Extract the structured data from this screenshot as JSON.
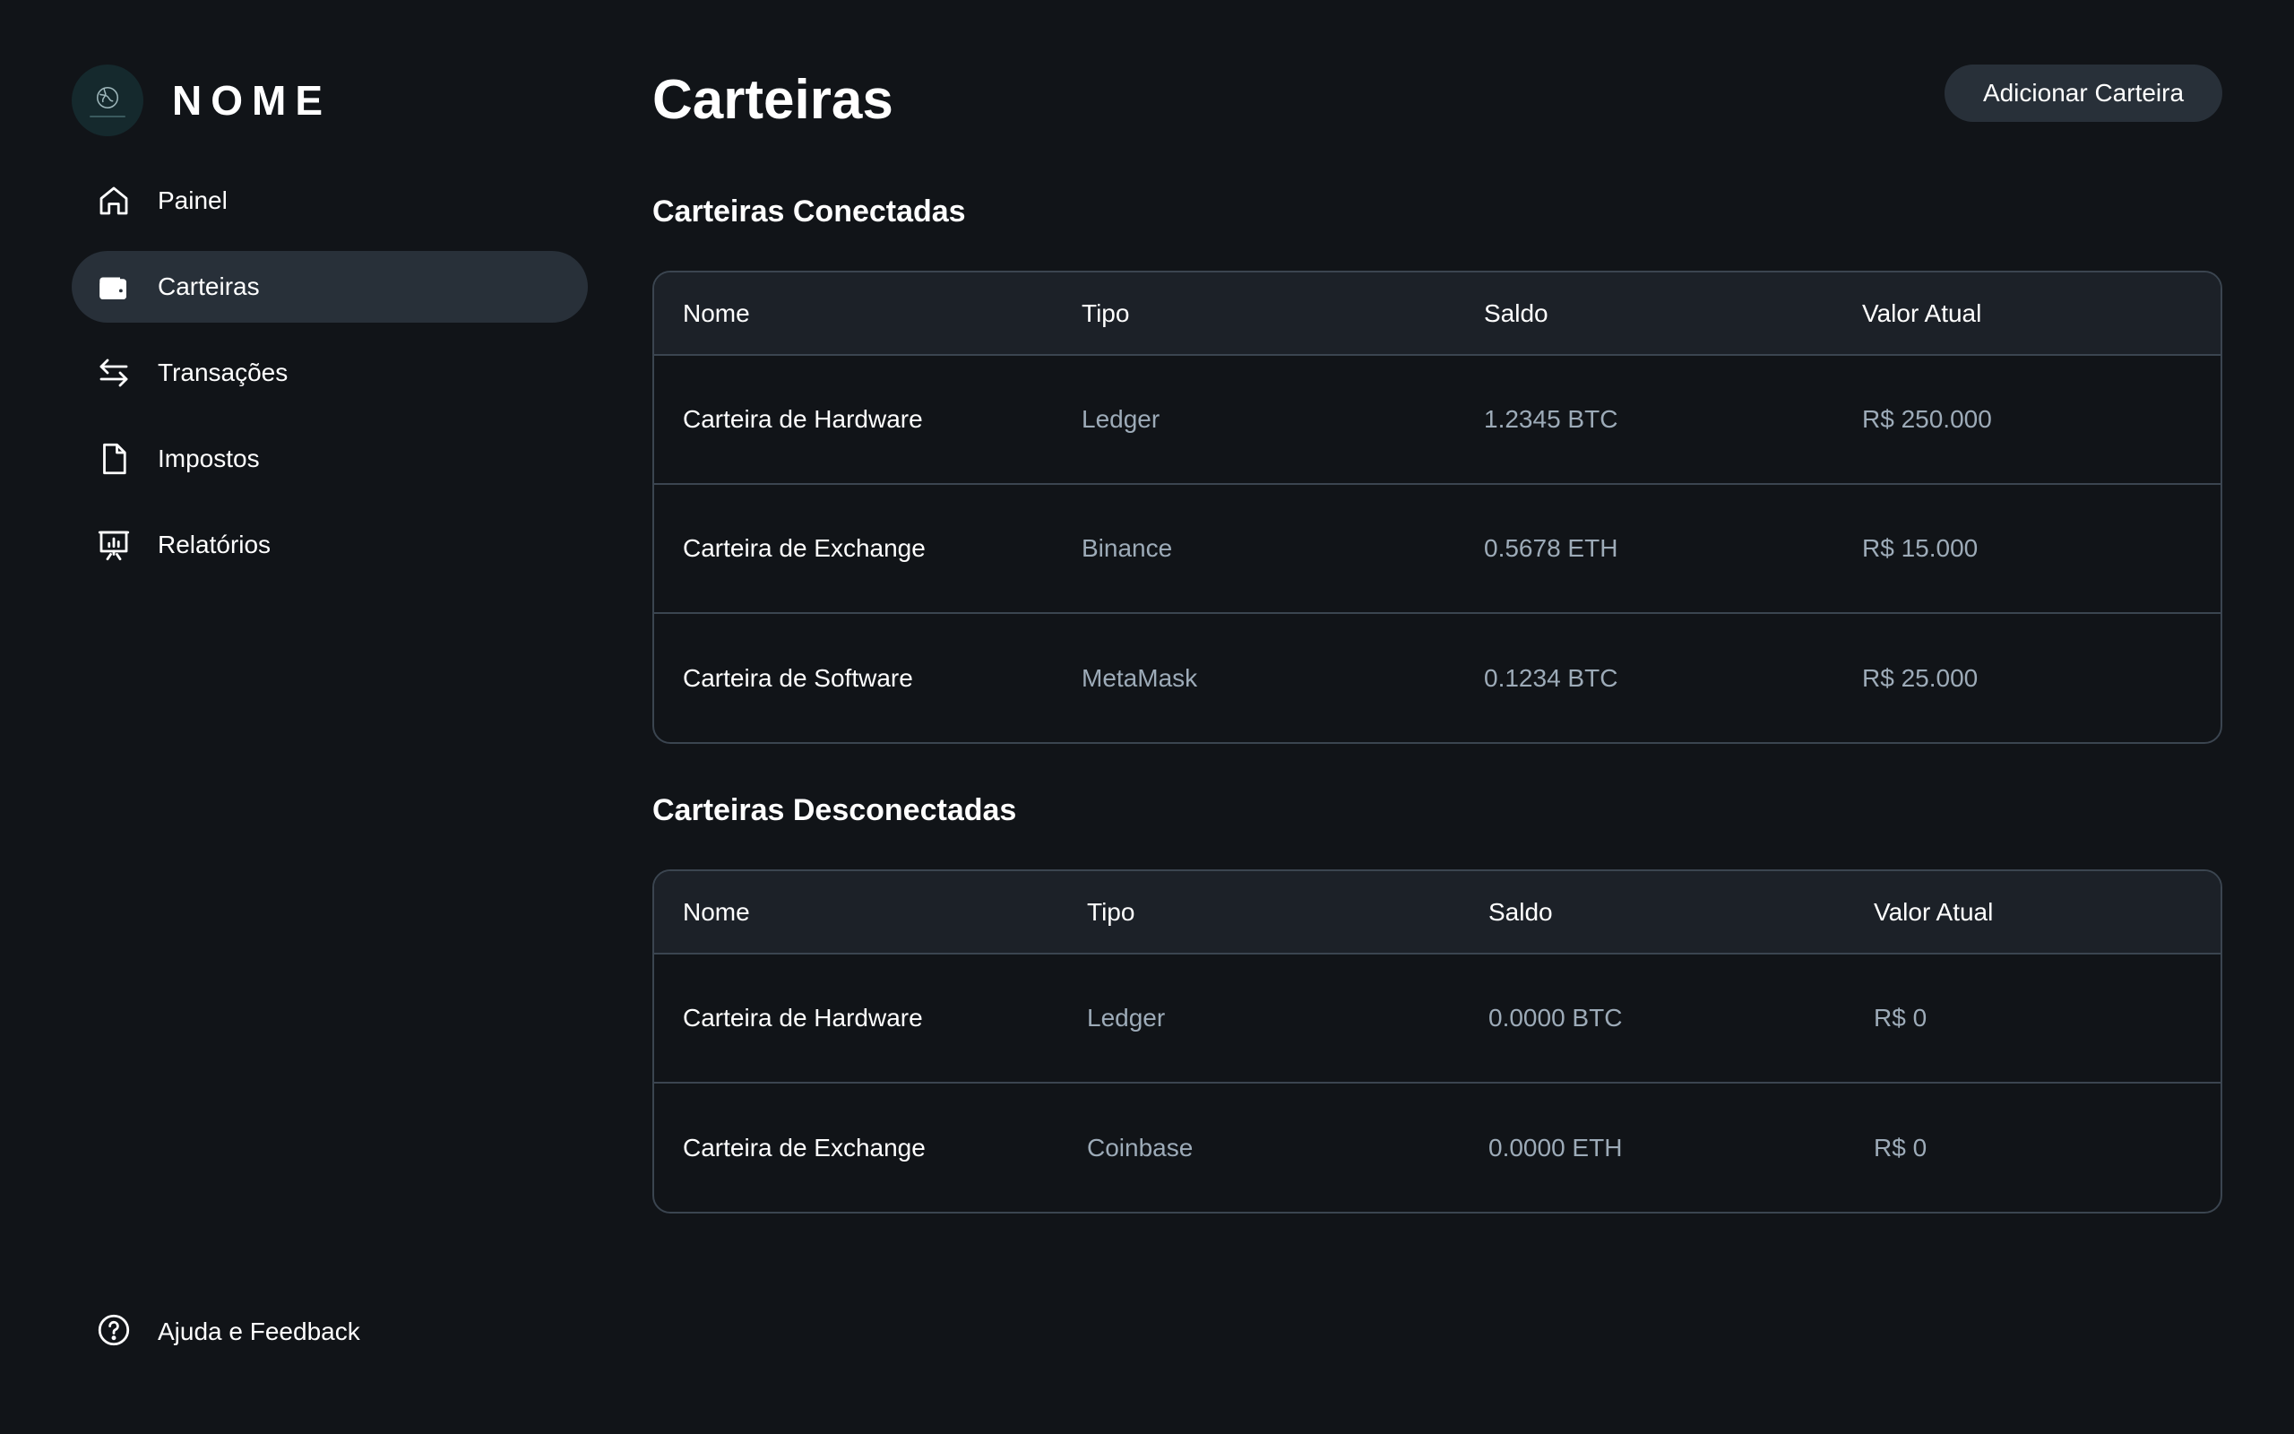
{
  "brand": {
    "name": "NOME",
    "logo_icon": "globe-icon"
  },
  "sidebar": {
    "items": [
      {
        "label": "Painel",
        "icon": "home-icon",
        "active": false
      },
      {
        "label": "Carteiras",
        "icon": "wallet-icon",
        "active": true
      },
      {
        "label": "Transações",
        "icon": "arrows-swap-icon",
        "active": false
      },
      {
        "label": "Impostos",
        "icon": "document-icon",
        "active": false
      },
      {
        "label": "Relatórios",
        "icon": "presentation-chart-icon",
        "active": false
      }
    ],
    "help": {
      "label": "Ajuda e Feedback",
      "icon": "help-circle-icon"
    }
  },
  "header": {
    "title": "Carteiras",
    "add_button": "Adicionar Carteira"
  },
  "connected": {
    "title": "Carteiras Conectadas",
    "columns": [
      "Nome",
      "Tipo",
      "Saldo",
      "Valor Atual"
    ],
    "rows": [
      [
        "Carteira de Hardware",
        "Ledger",
        "1.2345 BTC",
        "R$ 250.000"
      ],
      [
        "Carteira de Exchange",
        "Binance",
        "0.5678 ETH",
        "R$ 15.000"
      ],
      [
        "Carteira de Software",
        "MetaMask",
        "0.1234 BTC",
        "R$ 25.000"
      ]
    ]
  },
  "disconnected": {
    "title": "Carteiras Desconectadas",
    "columns": [
      "Nome",
      "Tipo",
      "Saldo",
      "Valor Atual"
    ],
    "rows": [
      [
        "Carteira de Hardware",
        "Ledger",
        "0.0000 BTC",
        "R$ 0"
      ],
      [
        "Carteira de Exchange",
        "Coinbase",
        "0.0000 ETH",
        "R$ 0"
      ]
    ]
  },
  "colors": {
    "background": "#111418",
    "surface": "#283039",
    "header_row": "#1c2128",
    "border": "#3b4550",
    "muted_text": "#9dabb8",
    "text": "#ffffff"
  }
}
